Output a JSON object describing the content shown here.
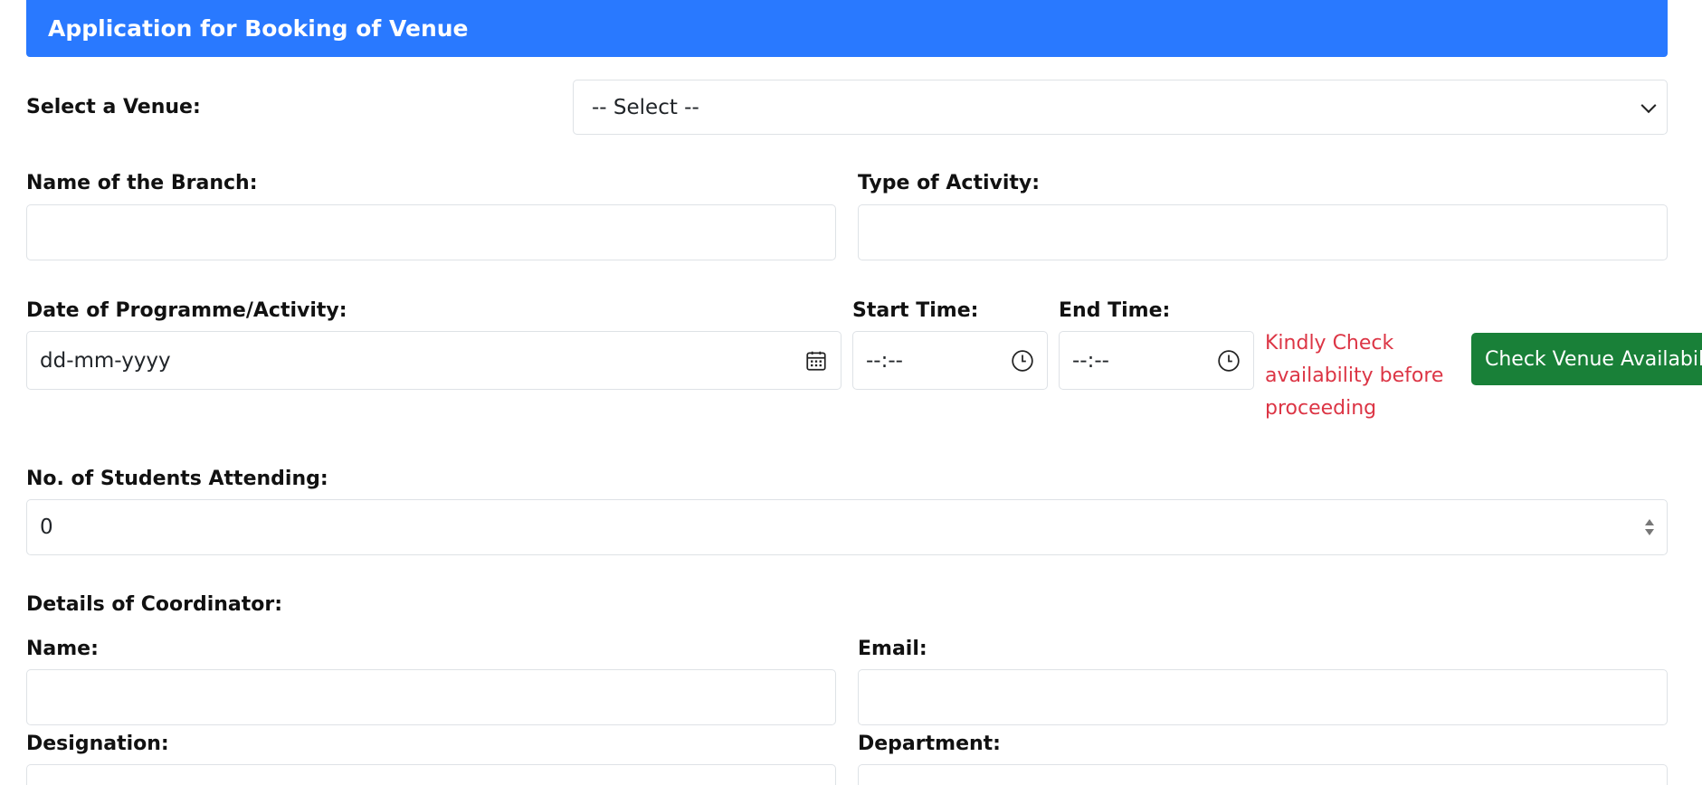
{
  "header": {
    "title": "Application for Booking of Venue",
    "color": "#2979ff"
  },
  "venue": {
    "label": "Select a Venue:",
    "selected": "-- Select --"
  },
  "branch": {
    "label": "Name of the Branch:",
    "value": ""
  },
  "activity": {
    "label": "Type of Activity:",
    "value": ""
  },
  "date": {
    "label": "Date of Programme/Activity:",
    "placeholder": "dd-mm-yyyy",
    "icon": "calendar-icon"
  },
  "start_time": {
    "label": "Start Time:",
    "placeholder": "--:--",
    "icon": "clock-icon"
  },
  "end_time": {
    "label": "End Time:",
    "placeholder": "--:--",
    "icon": "clock-icon"
  },
  "availability": {
    "warning": "Kindly Check availability before proceeding",
    "warning_color": "#dc3545",
    "button_label": "Check Venue Availability",
    "button_color": "#198038"
  },
  "students": {
    "label": "No. of Students Attending:",
    "value": "0"
  },
  "coordinator": {
    "section_title": "Details of Coordinator:",
    "name_label": "Name:",
    "email_label": "Email:",
    "designation_label": "Designation:",
    "department_label": "Department:"
  }
}
